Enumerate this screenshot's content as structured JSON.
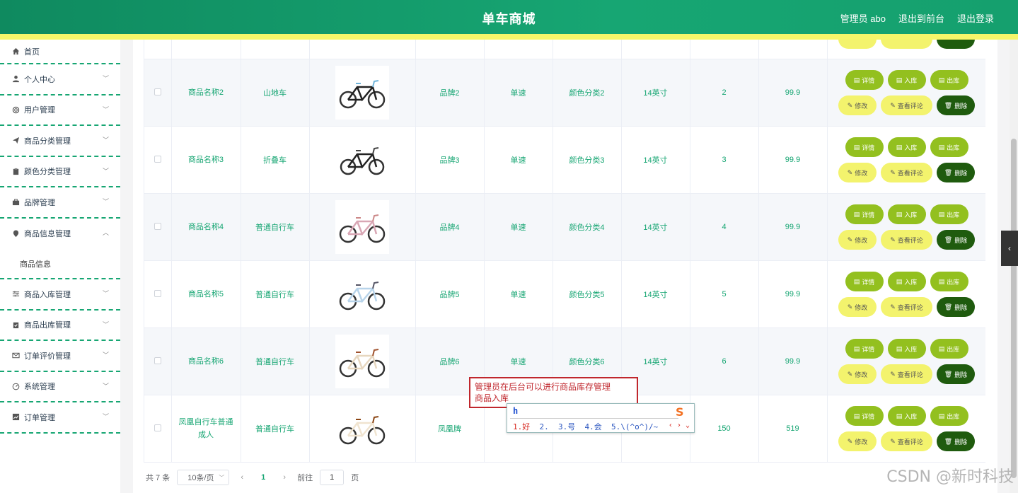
{
  "header": {
    "title": "单车商城",
    "admin_label": "管理员 abo",
    "back_front": "退出到前台",
    "logout": "退出登录"
  },
  "sidebar": {
    "items": [
      {
        "label": "首页",
        "icon": "home-icon",
        "chevron": false
      },
      {
        "label": "个人中心",
        "icon": "user-icon",
        "chevron": true
      },
      {
        "label": "用户管理",
        "icon": "users-icon",
        "chevron": true
      },
      {
        "label": "商品分类管理",
        "icon": "send-icon",
        "chevron": true
      },
      {
        "label": "颜色分类管理",
        "icon": "clipboard-icon",
        "chevron": true
      },
      {
        "label": "品牌管理",
        "icon": "briefcase-icon",
        "chevron": true
      },
      {
        "label": "商品信息管理",
        "icon": "location-icon",
        "chevron": true,
        "expanded": true
      },
      {
        "label": "商品入库管理",
        "icon": "sliders-icon",
        "chevron": true
      },
      {
        "label": "商品出库管理",
        "icon": "clipboard-check-icon",
        "chevron": true
      },
      {
        "label": "订单评价管理",
        "icon": "mail-icon",
        "chevron": true
      },
      {
        "label": "系统管理",
        "icon": "gauge-icon",
        "chevron": true
      },
      {
        "label": "订单管理",
        "icon": "chart-icon",
        "chevron": true
      }
    ],
    "subitem": "商品信息"
  },
  "table": {
    "rows": [
      {
        "name": "商品名称2",
        "category": "山地车",
        "brand": "品牌2",
        "speed": "单速",
        "color": "颜色分类2",
        "size": "14英寸",
        "stock": "2",
        "price": "99.9",
        "bike": "mountain"
      },
      {
        "name": "商品名称3",
        "category": "折叠车",
        "brand": "品牌3",
        "speed": "单速",
        "color": "颜色分类3",
        "size": "14英寸",
        "stock": "3",
        "price": "99.9",
        "bike": "folding"
      },
      {
        "name": "商品名称4",
        "category": "普通自行车",
        "brand": "品牌4",
        "speed": "单速",
        "color": "颜色分类4",
        "size": "14英寸",
        "stock": "4",
        "price": "99.9",
        "bike": "city-pink"
      },
      {
        "name": "商品名称5",
        "category": "普通自行车",
        "brand": "品牌5",
        "speed": "单速",
        "color": "颜色分类5",
        "size": "14英寸",
        "stock": "5",
        "price": "99.9",
        "bike": "city-blue"
      },
      {
        "name": "商品名称6",
        "category": "普通自行车",
        "brand": "品牌6",
        "speed": "单速",
        "color": "颜色分类6",
        "size": "14英寸",
        "stock": "6",
        "price": "99.9",
        "bike": "city-cream"
      },
      {
        "name": "凤凰自行车普通成人",
        "category": "普通自行车",
        "brand": "凤凰牌",
        "speed": "",
        "color": "",
        "size": "",
        "stock": "150",
        "price": "519",
        "bike": "city-brown"
      }
    ],
    "buttons": {
      "detail": "详情",
      "stock_in": "入库",
      "stock_out": "出库",
      "edit": "修改",
      "reviews": "查看评论",
      "delete": "删除"
    }
  },
  "pager": {
    "total": "共 7 条",
    "page_size": "10条/页",
    "current_page": "1",
    "goto_label": "前往",
    "goto_value": "1",
    "page_suffix": "页"
  },
  "annotation": {
    "line1": "管理员在后台可以进行商品库存管理",
    "line2": "商品入库"
  },
  "ime": {
    "composition": "h",
    "candidates": [
      "1.好",
      "2.",
      "3.号",
      "4.会",
      "5.\\(^o^)/~"
    ]
  },
  "watermark": "CSDN @新时科技",
  "colors": {
    "primary": "#17a673",
    "accent_yellow": "#f6f66a",
    "btn_green": "#93c01f",
    "btn_dark": "#1f5b0e"
  }
}
